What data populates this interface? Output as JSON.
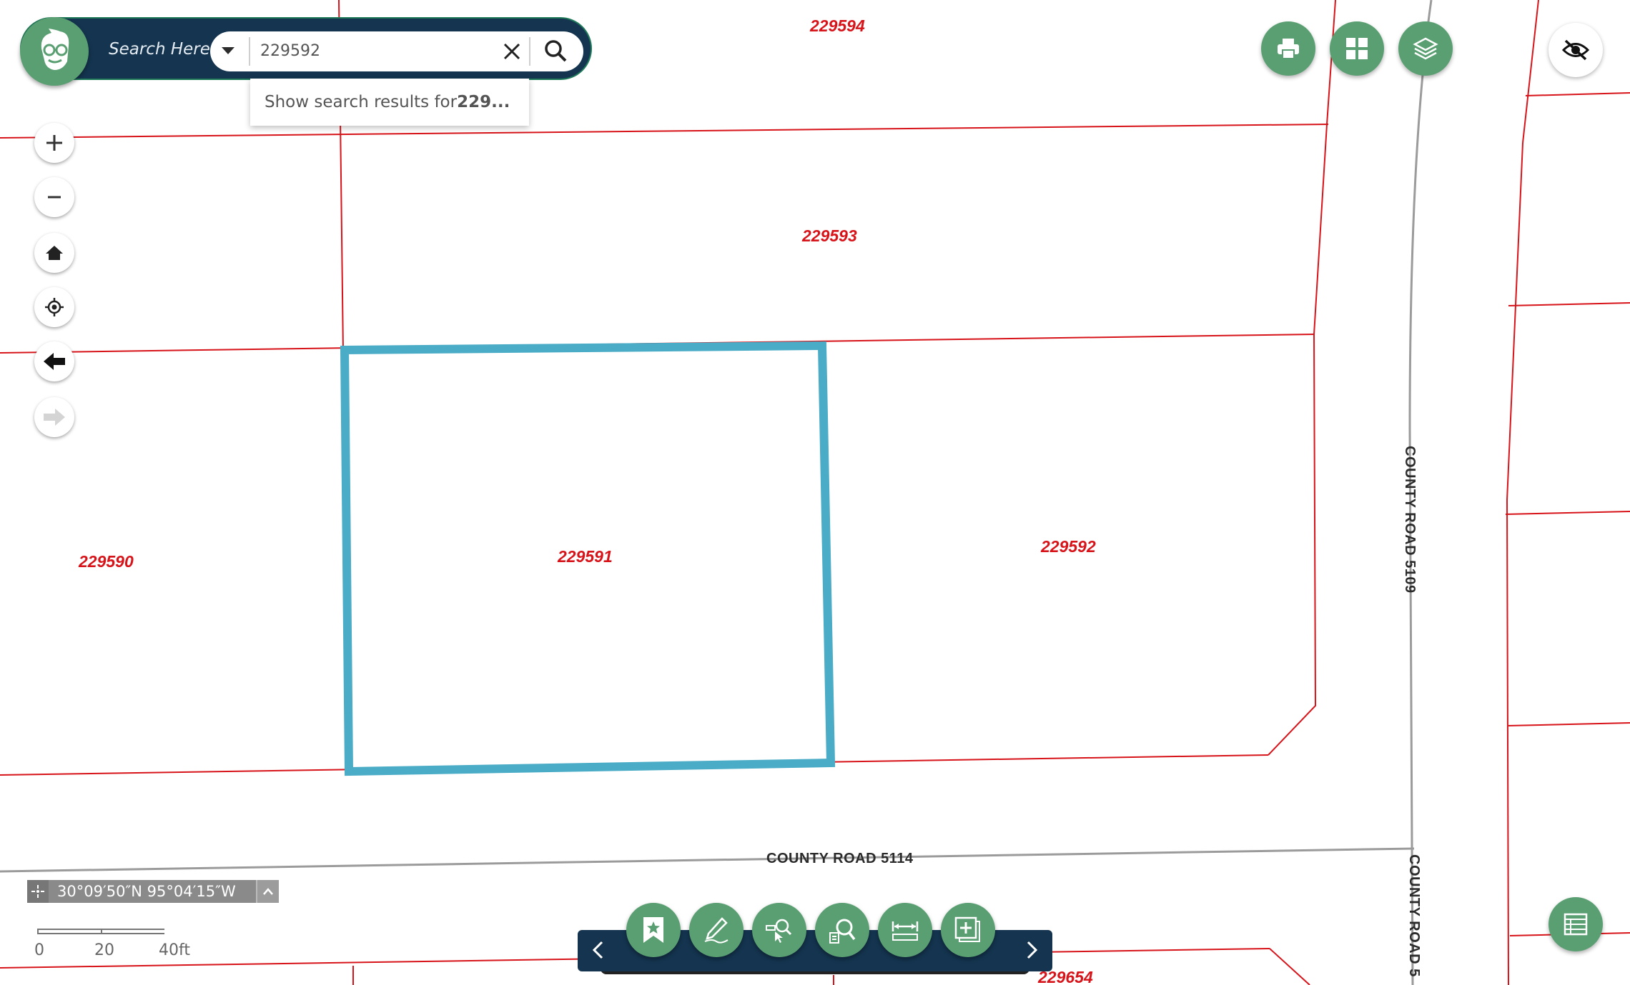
{
  "search": {
    "label": "Search Here:",
    "value": "229592",
    "suggestion_prefix": "Show search results for ",
    "suggestion_bold": "229..."
  },
  "map": {
    "parcels": [
      "229594",
      "229593",
      "229590",
      "229591",
      "229592",
      "229654"
    ],
    "roads": [
      "COUNTY ROAD 5114",
      "COUNTY ROAD 5109",
      "COUNTY ROAD 5"
    ],
    "selected_parcel": "229591",
    "colors": {
      "parcel_line": "#d7141a",
      "selection": "#4aacc6",
      "road_line": "#9b9b9b",
      "accent": "#5a9f72",
      "dark_bar": "#14344f"
    }
  },
  "coordinates": "30°09′50″N 95°04′15″W",
  "scale": {
    "labels": [
      "0",
      "20",
      "40ft"
    ]
  },
  "left_controls": [
    "zoom-in-icon",
    "zoom-out-icon",
    "home-icon",
    "locate-icon",
    "back-arrow-icon",
    "forward-arrow-icon"
  ],
  "top_right_buttons": [
    "print-icon",
    "grid-icon",
    "layers-icon"
  ],
  "toolbar_tools": [
    "bookmark-icon",
    "draw-icon",
    "identify-icon",
    "search-data-icon",
    "measure-icon",
    "add-data-icon"
  ]
}
